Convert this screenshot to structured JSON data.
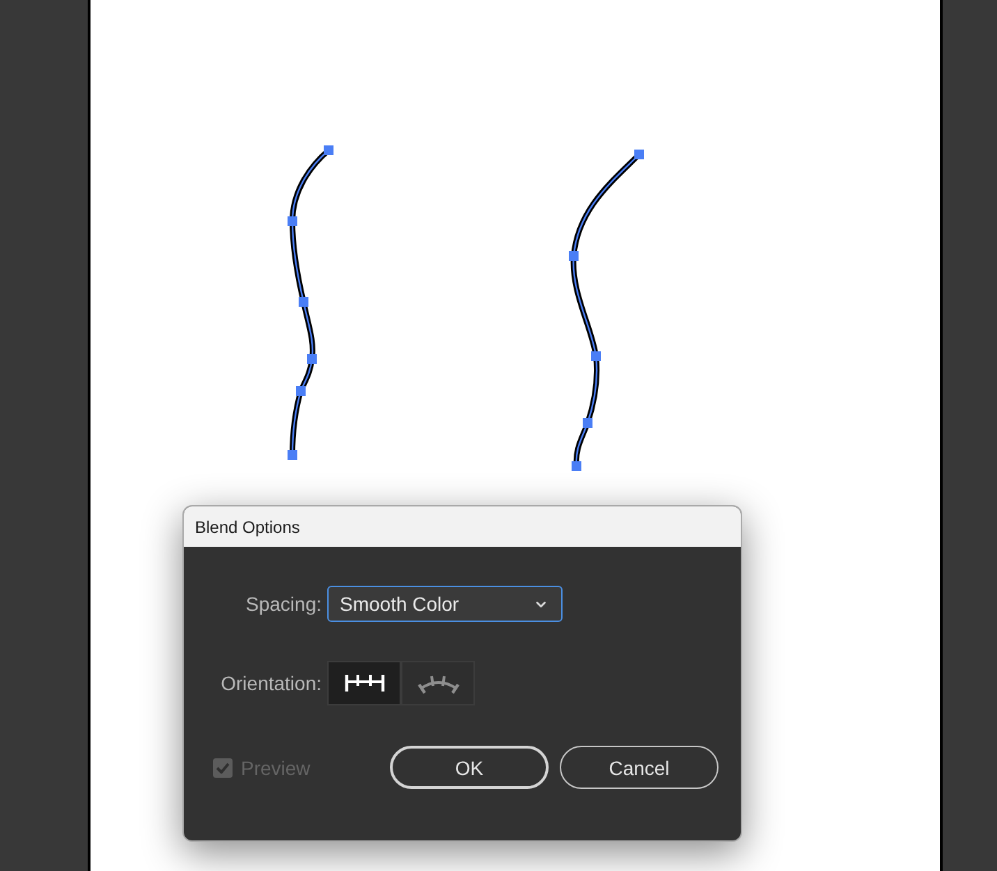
{
  "dialog": {
    "title": "Blend Options",
    "spacing": {
      "label": "Spacing:",
      "value": "Smooth Color",
      "focused": true
    },
    "orientation": {
      "label": "Orientation:",
      "options": [
        {
          "kind": "page",
          "selected": true
        },
        {
          "kind": "path",
          "selected": false
        }
      ]
    },
    "preview": {
      "label": "Preview",
      "checked": true,
      "disabled": true
    },
    "buttons": [
      {
        "label": "OK",
        "default": true
      },
      {
        "label": "Cancel",
        "default": false
      }
    ]
  }
}
